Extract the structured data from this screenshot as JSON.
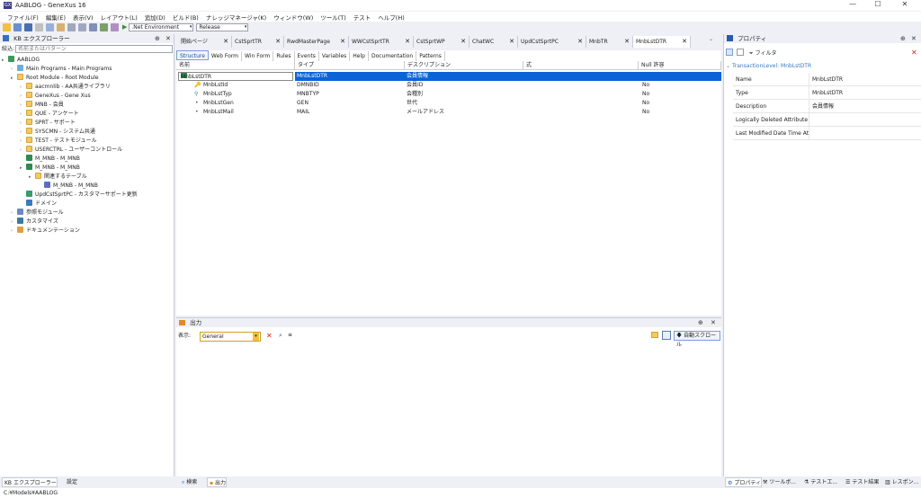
{
  "window": {
    "title": "AABLOG - GeneXus 16",
    "logo_text": "GX"
  },
  "menu": [
    "ファイル(F)",
    "編集(E)",
    "表示(V)",
    "レイアウト(L)",
    "追加(D)",
    "ビルド(B)",
    "ナレッジマネージャ(K)",
    "ウィンドウ(W)",
    "ツール(T)",
    "テスト",
    "ヘルプ(H)"
  ],
  "toolbar": {
    "environment": ".Net Environment",
    "config": "Release"
  },
  "kb_explorer": {
    "title": "KB エクスプローラー",
    "filter_label": "絞込:",
    "filter_placeholder": "名前またはパターン",
    "tree": [
      {
        "label": "AABLOG",
        "level": 0,
        "icon": "kb-icon"
      },
      {
        "label": "Main Programs - Main Programs",
        "level": 1,
        "icon": "folder-icon"
      },
      {
        "label": "Root Module - Root Module",
        "level": 1,
        "icon": "module-icon"
      },
      {
        "label": "aacmnlib - AA共通ライブラリ",
        "level": 2,
        "icon": "module-icon"
      },
      {
        "label": "GeneXus - Gene Xus",
        "level": 2,
        "icon": "module-icon"
      },
      {
        "label": "MNB - 会員",
        "level": 2,
        "icon": "folder-icon"
      },
      {
        "label": "QUE - アンケート",
        "level": 2,
        "icon": "folder-icon"
      },
      {
        "label": "SPRT - サポート",
        "level": 2,
        "icon": "folder-icon"
      },
      {
        "label": "SYSCMN - システム共通",
        "level": 2,
        "icon": "folder-icon"
      },
      {
        "label": "TEST - テストモジュール",
        "level": 2,
        "icon": "folder-icon"
      },
      {
        "label": "USERCTRL - ユーザーコントロール",
        "level": 2,
        "icon": "folder-icon"
      },
      {
        "label": "M_MNB - M_MNB",
        "level": 2,
        "icon": "transaction-icon"
      },
      {
        "label": "M_MNB - M_MNB",
        "level": 2,
        "icon": "transaction-icon"
      },
      {
        "label": "関連するテーブル",
        "level": 3,
        "icon": "folder-icon"
      },
      {
        "label": "M_MNB - M_MNB",
        "level": 4,
        "icon": "table-icon"
      },
      {
        "label": "UpdCstSprtPC - カスタマーサポート更新",
        "level": 2,
        "icon": "procedure-icon"
      },
      {
        "label": "ドメイン",
        "level": 2,
        "icon": "domain-icon"
      },
      {
        "label": "参照モジュール",
        "level": 1,
        "icon": "reference-icon"
      },
      {
        "label": "カスタマイズ",
        "level": 1,
        "icon": "customize-icon"
      },
      {
        "label": "ドキュメンテーション",
        "level": 1,
        "icon": "document-icon"
      }
    ],
    "bottom_tabs": [
      "KB エクスプローラー",
      "設定"
    ]
  },
  "doc_tabs": [
    "開始ページ",
    "CstSprtTR",
    "RwdMasterPage",
    "WWCstSprtTR",
    "CstSprtWP",
    "ChatWC",
    "UpdCstSprtPC",
    "MnbTR",
    "MnbLstDTR"
  ],
  "sub_tabs": [
    "Structure",
    "Web Form",
    "Win Form",
    "Rules",
    "Events",
    "Variables",
    "Help",
    "Documentation",
    "Patterns"
  ],
  "structure": {
    "headers": [
      "名前",
      "タイプ",
      "デスクリプション",
      "式",
      "Null 許容"
    ],
    "rows": [
      {
        "name": "MnbLstDTR",
        "type": "MnbLstDTR",
        "desc": "会員情報",
        "null": ""
      },
      {
        "name": "MnbLstId",
        "type": "DMNBID",
        "desc": "会員ID",
        "null": "No"
      },
      {
        "name": "MnbLstTyp",
        "type": "MNBTYP",
        "desc": "会種別",
        "null": "No"
      },
      {
        "name": "MnbLstGen",
        "type": "GEN",
        "desc": "世代",
        "null": "No"
      },
      {
        "name": "MnbLstMail",
        "type": "MAIL",
        "desc": "メールアドレス",
        "null": "No"
      }
    ]
  },
  "output": {
    "title": "出力",
    "show_label": "表示:",
    "show_value": "General",
    "auto_scroll": "自動スクロール"
  },
  "properties": {
    "title": "プロパティ",
    "filter_label": "フィルタ",
    "section": "TransactionLevel: MnbLstDTR",
    "rows": [
      {
        "key": "Name",
        "value": "MnbLstDTR"
      },
      {
        "key": "Type",
        "value": "MnbLstDTR"
      },
      {
        "key": "Description",
        "value": "会員情報"
      },
      {
        "key": "Logically Deleted Attribute",
        "value": ""
      },
      {
        "key": "Last Modified Date Time At",
        "value": ""
      }
    ]
  },
  "center_bottom_tabs": [
    "検索",
    "出力"
  ],
  "right_bottom_tabs": [
    "プロパティ",
    "ツールボ...",
    "テストエ...",
    "テスト結果",
    "レスポン..."
  ],
  "status": "C:¥Models¥AABLOG"
}
